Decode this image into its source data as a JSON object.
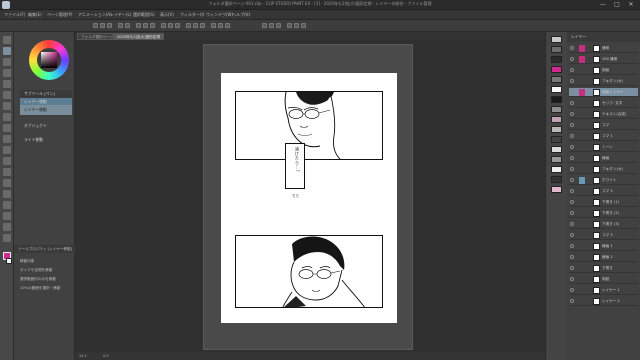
{
  "window": {
    "title": "フォルダ選択ページ-001.clip - CLIP STUDIO PAINT EX - [3] - 2020年も2(拡大)図形定規 - レイヤーの結合 - ファイル管理",
    "controls": [
      "—",
      "□",
      "✕"
    ]
  },
  "menu": [
    "ファイル(F)",
    "編集(E)",
    "ページ管理(P)",
    "アニメーション(A)",
    "レイヤー(L)",
    "選択範囲(S)",
    "表示(V)",
    "フィルター(I)",
    "ウィンドウ(W)",
    "ヘルプ(H)"
  ],
  "tabs": [
    "フォルダ選択ページ",
    "2020年も2(拡大)図形定規"
  ],
  "subtool_panel": {
    "header": "サブツール [ペン]",
    "rows": [
      "レイヤー移動",
      "レイヤー移動",
      "オブジェクト",
      "ライト移動"
    ],
    "properties_header": "ツールプロパティ [レイヤー移動]",
    "properties": [
      "移動対象",
      "ガイドや定規を移動",
      "選択範囲内のみを移動",
      "10%の範囲を選択・移動"
    ]
  },
  "canvas": {
    "balloon_text": "溶けたら…?",
    "hand_text": "ちら"
  },
  "layers": {
    "header": "レイヤー",
    "rows": [
      "通常",
      "100 通常",
      "用紙",
      "フキダシ(大)",
      "用紙レイヤー",
      "セリフ: 文字",
      "テキスト(合成)",
      "コマ",
      "コマ 1",
      "トーン",
      "線画",
      "フキダシ(大)",
      "ホワイト",
      "コマ 2",
      "下書き (1)",
      "下書き (2)",
      "下書き (3)",
      "コマ 3",
      "線画 1",
      "線画 2",
      "下書き",
      "用紙",
      "レイヤー 1",
      "レイヤー 2"
    ]
  },
  "status": {
    "zoom": "34.2",
    "angle": "0.0"
  },
  "colors": {
    "accent": "#7b91a3",
    "main_color": "#d12a8f",
    "canvas_bg": "#303030"
  }
}
